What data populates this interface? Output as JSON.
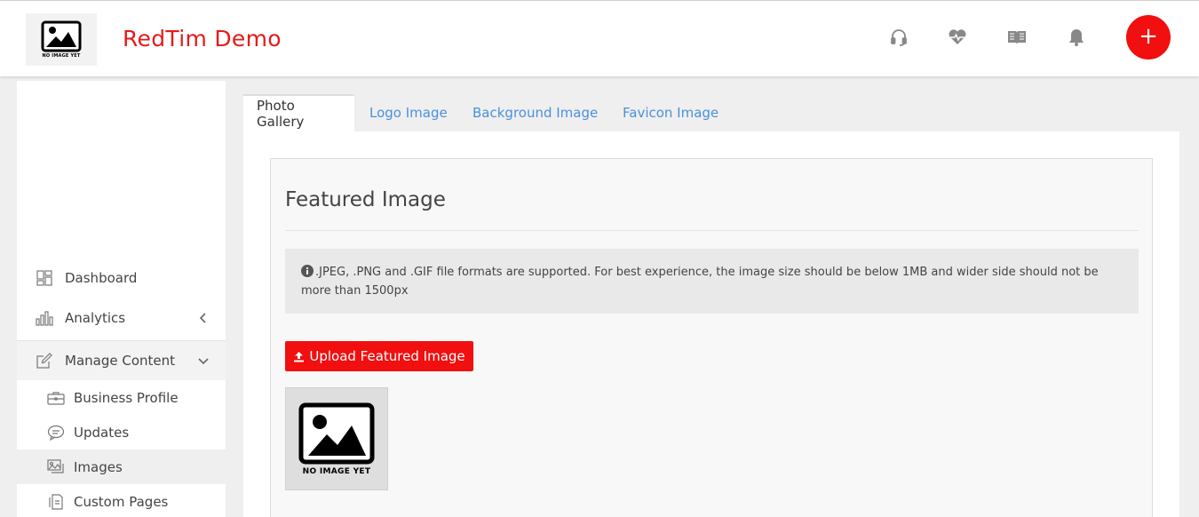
{
  "header": {
    "brand": "RedTim Demo",
    "logo_caption": "NO IMAGE YET",
    "icons": [
      "headset-icon",
      "heartbeat-icon",
      "book-icon",
      "bell-icon"
    ],
    "add_label": "+"
  },
  "sidebar": {
    "items": [
      {
        "label": "Dashboard",
        "icon": "dashboard-icon"
      },
      {
        "label": "Analytics",
        "icon": "bar-chart-icon"
      },
      {
        "label": "Manage Content",
        "icon": "edit-icon"
      }
    ],
    "sub_items": [
      {
        "label": "Business Profile",
        "icon": "briefcase-icon"
      },
      {
        "label": "Updates",
        "icon": "speech-bubble-icon"
      },
      {
        "label": "Images",
        "icon": "images-icon",
        "active": true
      },
      {
        "label": "Custom Pages",
        "icon": "document-icon"
      }
    ]
  },
  "main": {
    "tabs": [
      {
        "label": "Photo Gallery",
        "active": true
      },
      {
        "label": "Logo Image"
      },
      {
        "label": "Background Image"
      },
      {
        "label": "Favicon Image"
      }
    ],
    "card": {
      "title": "Featured Image",
      "info": ".JPEG, .PNG and .GIF file formats are supported. For best experience, the image size should be below 1MB and wider side should not be more than 1500px",
      "upload_label": "Upload Featured Image",
      "thumb_caption": "NO IMAGE YET"
    }
  },
  "colors": {
    "brand_red": "#e51b1b",
    "button_red": "#f10f0f",
    "link_blue": "#4a90d9"
  }
}
